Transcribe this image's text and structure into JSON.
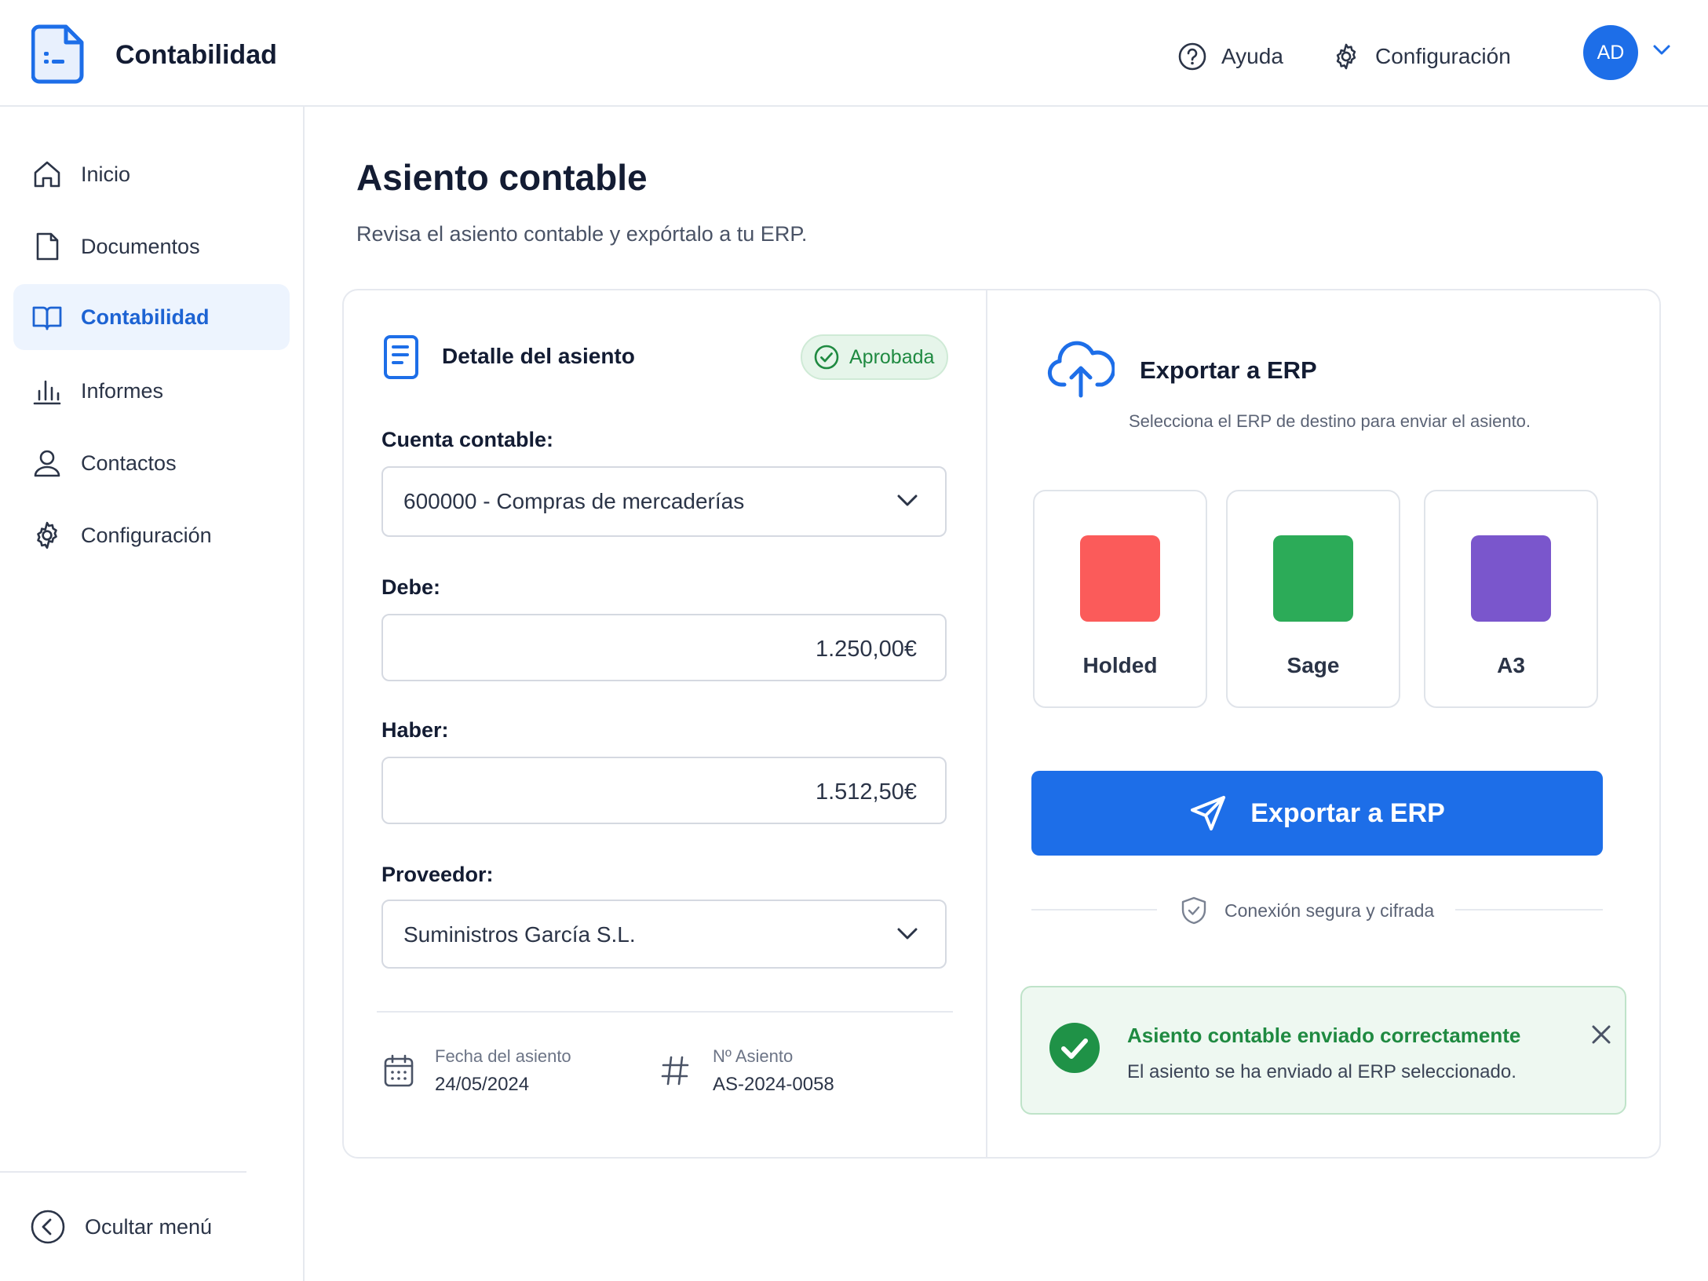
{
  "app": {
    "title": "Contabilidad",
    "avatar_initials": "AD"
  },
  "header": {
    "help_label": "Ayuda",
    "config_label": "Configuración"
  },
  "sidebar": {
    "items": [
      {
        "label": "Inicio",
        "icon": "home-icon",
        "active": false
      },
      {
        "label": "Documentos",
        "icon": "document-icon",
        "active": false
      },
      {
        "label": "Contabilidad",
        "icon": "book-icon",
        "active": true
      },
      {
        "label": "Informes",
        "icon": "bar-chart-icon",
        "active": false
      },
      {
        "label": "Contactos",
        "icon": "user-icon",
        "active": false
      },
      {
        "label": "Configuración",
        "icon": "gear-icon",
        "active": false
      }
    ],
    "collapse_label": "Ocultar menú"
  },
  "page": {
    "title": "Asiento contable",
    "subtitle": "Revisa el asiento contable y expórtalo a tu ERP."
  },
  "detail": {
    "title": "Detalle del asiento",
    "status": "Aprobada",
    "account_label": "Cuenta contable:",
    "account_value": "600000 - Compras de mercaderías",
    "debit_label": "Debe:",
    "debit_value": "1.250,00€",
    "credit_label": "Haber:",
    "credit_value": "1.512,50€",
    "supplier_label": "Proveedor:",
    "supplier_value": "Suministros García S.L.",
    "date_label": "Fecha del asiento",
    "date_value": "24/05/2024",
    "number_label": "Nº Asiento",
    "number_value": "AS-2024-0058"
  },
  "export": {
    "title": "Exportar a ERP",
    "subtitle": "Selecciona el ERP de destino para enviar el asiento.",
    "erps": [
      {
        "name": "Holded",
        "color": "#fb5b5a"
      },
      {
        "name": "Sage",
        "color": "#2cab58"
      },
      {
        "name": "A3",
        "color": "#7a56cc"
      }
    ],
    "button_label": "Exportar a ERP",
    "secure_label": "Conexión segura y cifrada",
    "toast_title": "Asiento contable enviado correctamente",
    "toast_text": "El asiento se ha enviado al ERP seleccionado."
  },
  "colors": {
    "accent": "#1d6ee8",
    "success": "#1f8a41",
    "active_nav_bg": "#edf4fe"
  }
}
